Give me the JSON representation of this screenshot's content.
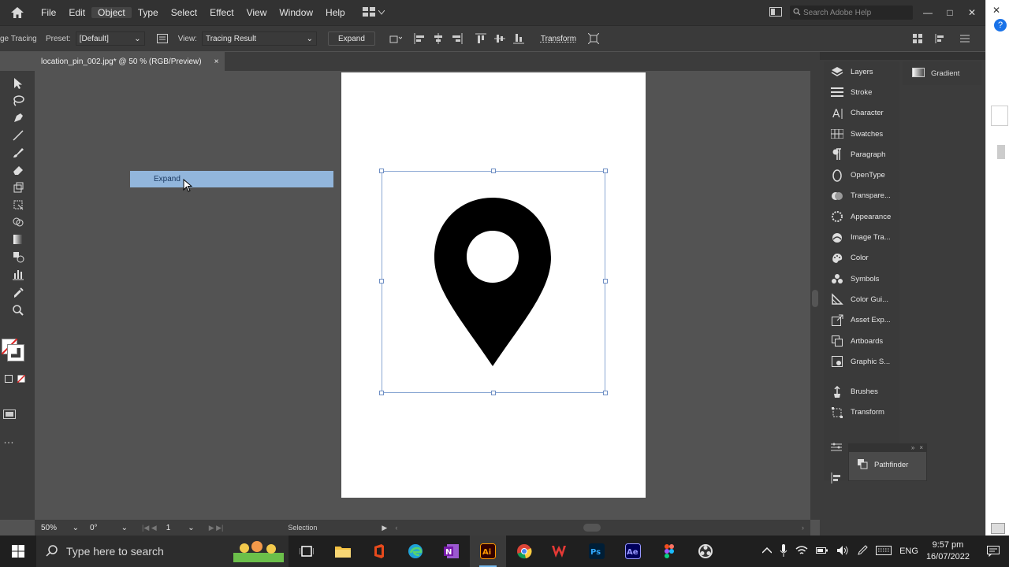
{
  "menubar": {
    "items": [
      "File",
      "Edit",
      "Object",
      "Type",
      "Select",
      "Effect",
      "View",
      "Window",
      "Help"
    ],
    "active": "Object",
    "search_placeholder": "Search Adobe Help"
  },
  "controlbar": {
    "mode_label": "ge Tracing",
    "preset_label": "Preset:",
    "preset_value": "[Default]",
    "view_label": "View:",
    "view_value": "Tracing Result",
    "expand_button": "Expand",
    "transform_button": "Transform"
  },
  "document": {
    "tab_title": "location_pin_002.jpg* @ 50 % (RGB/Preview)",
    "close": "×",
    "tooltip": "Expand"
  },
  "status": {
    "zoom": "50%",
    "rotation": "0°",
    "artboard": "1",
    "tool": "Selection"
  },
  "panels": {
    "dock1": [
      "Layers",
      "Stroke",
      "Character",
      "Swatches",
      "Paragraph",
      "OpenType",
      "Transpare...",
      "Appearance",
      "Image Tra...",
      "Color",
      "Symbols",
      "Color Gui...",
      "Asset Exp...",
      "Artboards",
      "Graphic S...",
      "Brushes",
      "Transform"
    ],
    "dock2": [
      "Gradient"
    ],
    "floating": [
      "Pathfinder"
    ]
  },
  "taskbar": {
    "search_placeholder": "Type here to search",
    "time": "9:57 pm",
    "date": "16/07/2022",
    "lang": "ENG"
  },
  "colors": {
    "accent": "#92b6dc",
    "selection": "#8aa7d3"
  }
}
